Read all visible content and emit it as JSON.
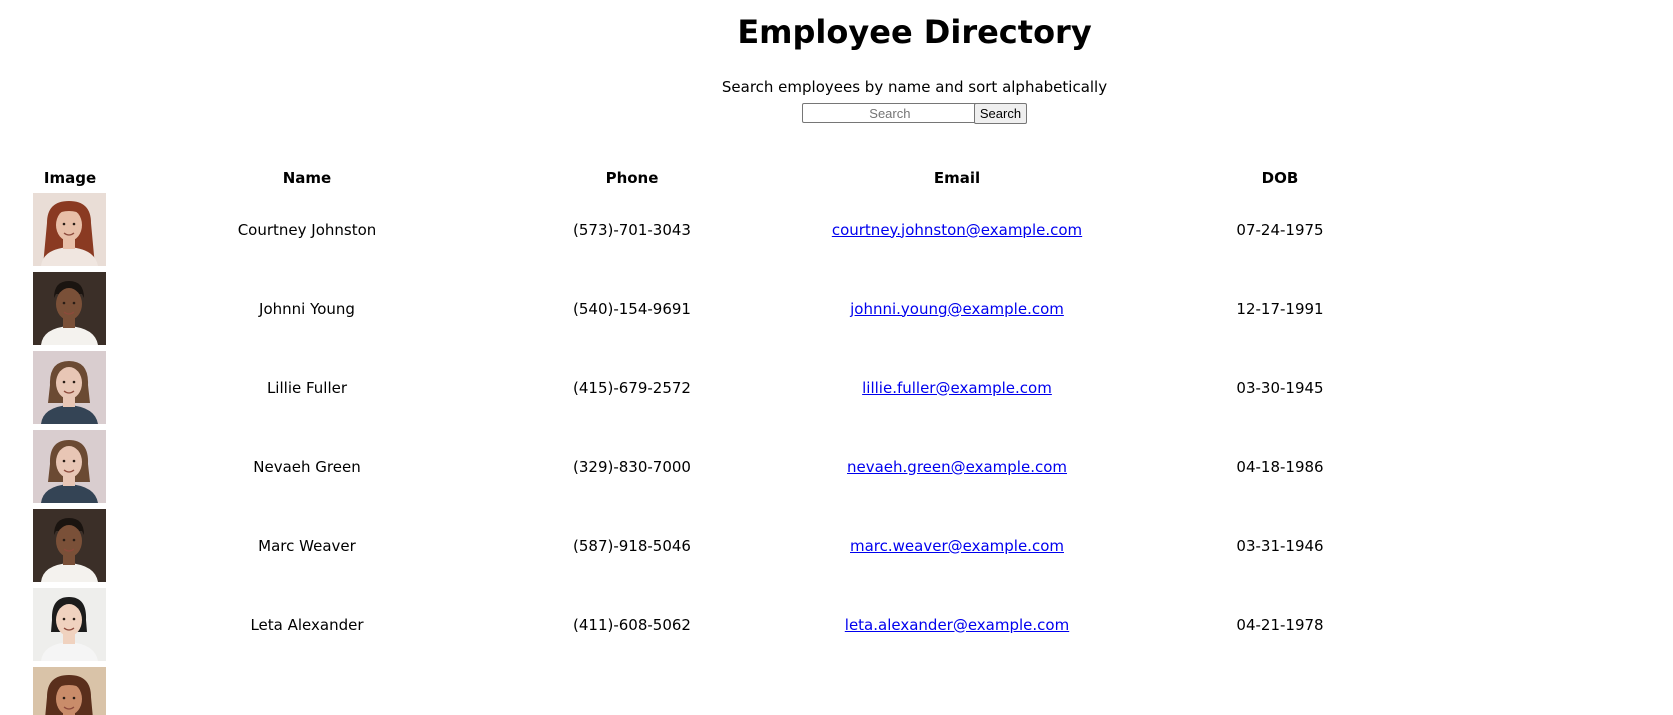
{
  "header": {
    "title": "Employee Directory",
    "subtitle": "Search employees by name and sort alphabetically"
  },
  "search": {
    "placeholder": "Search",
    "value": "",
    "button_label": "Search"
  },
  "table": {
    "columns": [
      "Image",
      "Name",
      "Phone",
      "Email",
      "DOB"
    ],
    "rows": [
      {
        "name": "Courtney Johnston",
        "phone": "(573)-701-3043",
        "email": "courtney.johnston@example.com",
        "dob": "07-24-1975",
        "avatar": {
          "bg": "#e9ddd6",
          "hair": "#8a3a22",
          "skin": "#e8bfa8",
          "shirt": "#f0e6e0",
          "style": "long-fringe"
        }
      },
      {
        "name": "Johnni Young",
        "phone": "(540)-154-9691",
        "email": "johnni.young@example.com",
        "dob": "12-17-1991",
        "avatar": {
          "bg": "#3b2f28",
          "hair": "#1a1410",
          "skin": "#7a5038",
          "shirt": "#f4f2ee",
          "style": "short"
        }
      },
      {
        "name": "Lillie Fuller",
        "phone": "(415)-679-2572",
        "email": "lillie.fuller@example.com",
        "dob": "03-30-1945",
        "avatar": {
          "bg": "#d9cdcf",
          "hair": "#6b4a33",
          "skin": "#e8c6b5",
          "shirt": "#344455",
          "style": "bob"
        }
      },
      {
        "name": "Nevaeh Green",
        "phone": "(329)-830-7000",
        "email": "nevaeh.green@example.com",
        "dob": "04-18-1986",
        "avatar": {
          "bg": "#d9cdcf",
          "hair": "#6b4a33",
          "skin": "#e8c6b5",
          "shirt": "#344455",
          "style": "bob"
        }
      },
      {
        "name": "Marc Weaver",
        "phone": "(587)-918-5046",
        "email": "marc.weaver@example.com",
        "dob": "03-31-1946",
        "avatar": {
          "bg": "#3b2f28",
          "hair": "#1a1410",
          "skin": "#7a5038",
          "shirt": "#f4f2ee",
          "style": "short"
        }
      },
      {
        "name": "Leta Alexander",
        "phone": "(411)-608-5062",
        "email": "leta.alexander@example.com",
        "dob": "04-21-1978",
        "avatar": {
          "bg": "#eeeeec",
          "hair": "#1c1c1c",
          "skin": "#f0d2bf",
          "shirt": "#f5f5f5",
          "style": "short-bob"
        }
      },
      {
        "name": "",
        "phone": "",
        "email": "",
        "dob": "",
        "avatar": {
          "bg": "#d9c3a8",
          "hair": "#5a2f1c",
          "skin": "#c98c6a",
          "shirt": "#c9b08e",
          "style": "long-fringe"
        }
      }
    ]
  }
}
